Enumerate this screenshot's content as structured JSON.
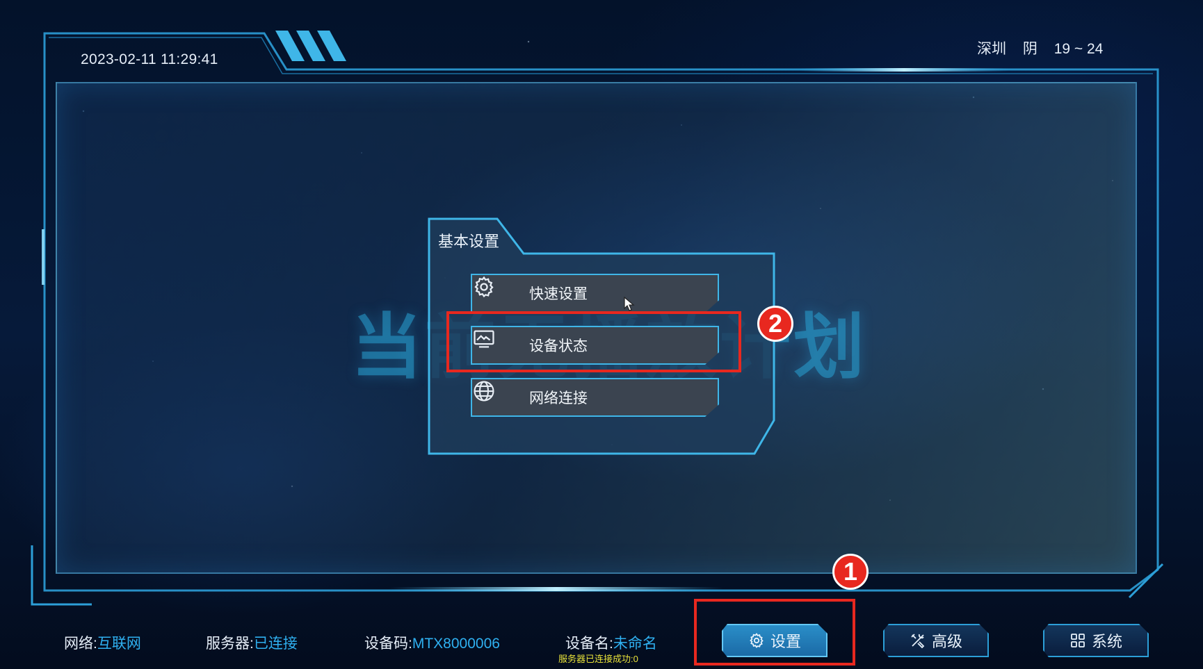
{
  "header": {
    "datetime": "2023-02-11 11:29:41",
    "weather": {
      "city": "深圳",
      "condition": "阴",
      "temperature": "19 ~ 24"
    }
  },
  "main": {
    "background_title": "当前无播放计划"
  },
  "menu": {
    "title": "基本设置",
    "items": [
      {
        "label": "快速设置",
        "icon": "gear-icon"
      },
      {
        "label": "设备状态",
        "icon": "monitor-icon"
      },
      {
        "label": "网络连接",
        "icon": "globe-icon"
      }
    ]
  },
  "annotations": {
    "marker_1": "1",
    "marker_2": "2"
  },
  "status_bar": {
    "network": {
      "label": "网络:",
      "value": "互联网"
    },
    "server": {
      "label": "服务器:",
      "value": "已连接"
    },
    "device_code": {
      "label": "设备码:",
      "value": "MTX8000006"
    },
    "device_name": {
      "label": "设备名:",
      "value": "未命名"
    },
    "server_message": "服务器已连接成功:0"
  },
  "nav_buttons": [
    {
      "label": "设置",
      "icon": "gear-icon",
      "active": true
    },
    {
      "label": "高级",
      "icon": "tools-icon",
      "active": false
    },
    {
      "label": "系统",
      "icon": "grid-icon",
      "active": false
    }
  ],
  "colors": {
    "accent": "#2fb0f0",
    "frame": "#3fb6e8",
    "annotation": "#e8281f",
    "server_message": "#e8e23a"
  }
}
